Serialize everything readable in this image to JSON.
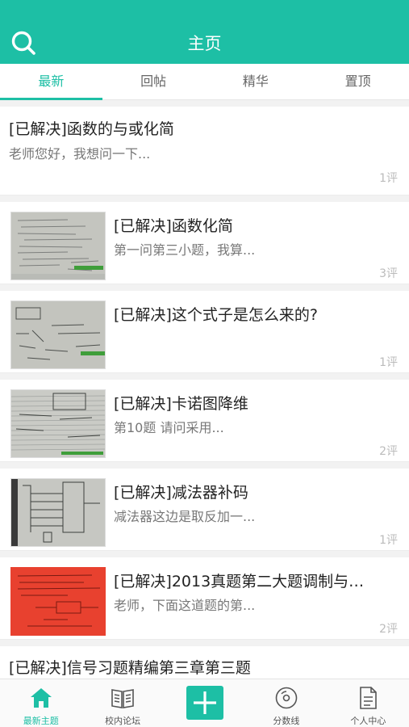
{
  "header": {
    "title": "主页",
    "search_icon": "search-icon"
  },
  "tabs": [
    {
      "label": "最新",
      "active": true
    },
    {
      "label": "回帖",
      "active": false
    },
    {
      "label": "精华",
      "active": false
    },
    {
      "label": "置顶",
      "active": false
    }
  ],
  "posts": [
    {
      "title": "[已解决]函数的与或化简",
      "excerpt": "老师您好，我想问一下...",
      "comments": "1评"
    },
    {
      "title": "[已解决]函数化简",
      "excerpt": "第一问第三小题，我算...",
      "comments": "3评"
    },
    {
      "title": "[已解决]这个式子是怎么来的?",
      "excerpt": "",
      "comments": "1评"
    },
    {
      "title": "[已解决]卡诺图降维",
      "excerpt": "第10题  请问采用...",
      "comments": "2评"
    },
    {
      "title": "[已解决]减法器补码",
      "excerpt": "减法器这边是取反加一...",
      "comments": "1评"
    },
    {
      "title": "[已解决]2013真题第二大题调制与…",
      "excerpt": "老师，下面这道题的第...",
      "comments": "2评"
    },
    {
      "title": "[已解决]信号习题精编第三章第三题",
      "excerpt": "",
      "comments": ""
    }
  ],
  "tabbar": {
    "items": [
      {
        "label": "最新主题",
        "icon": "home-icon",
        "active": true
      },
      {
        "label": "校内论坛",
        "icon": "book-icon",
        "active": false
      },
      {
        "label": "",
        "icon": "plus-icon",
        "active": false
      },
      {
        "label": "分数线",
        "icon": "disc-icon",
        "active": false
      },
      {
        "label": "个人中心",
        "icon": "document-icon",
        "active": false
      }
    ]
  },
  "colors": {
    "accent": "#1dbfa5",
    "thumb_red": "#e8412f"
  }
}
